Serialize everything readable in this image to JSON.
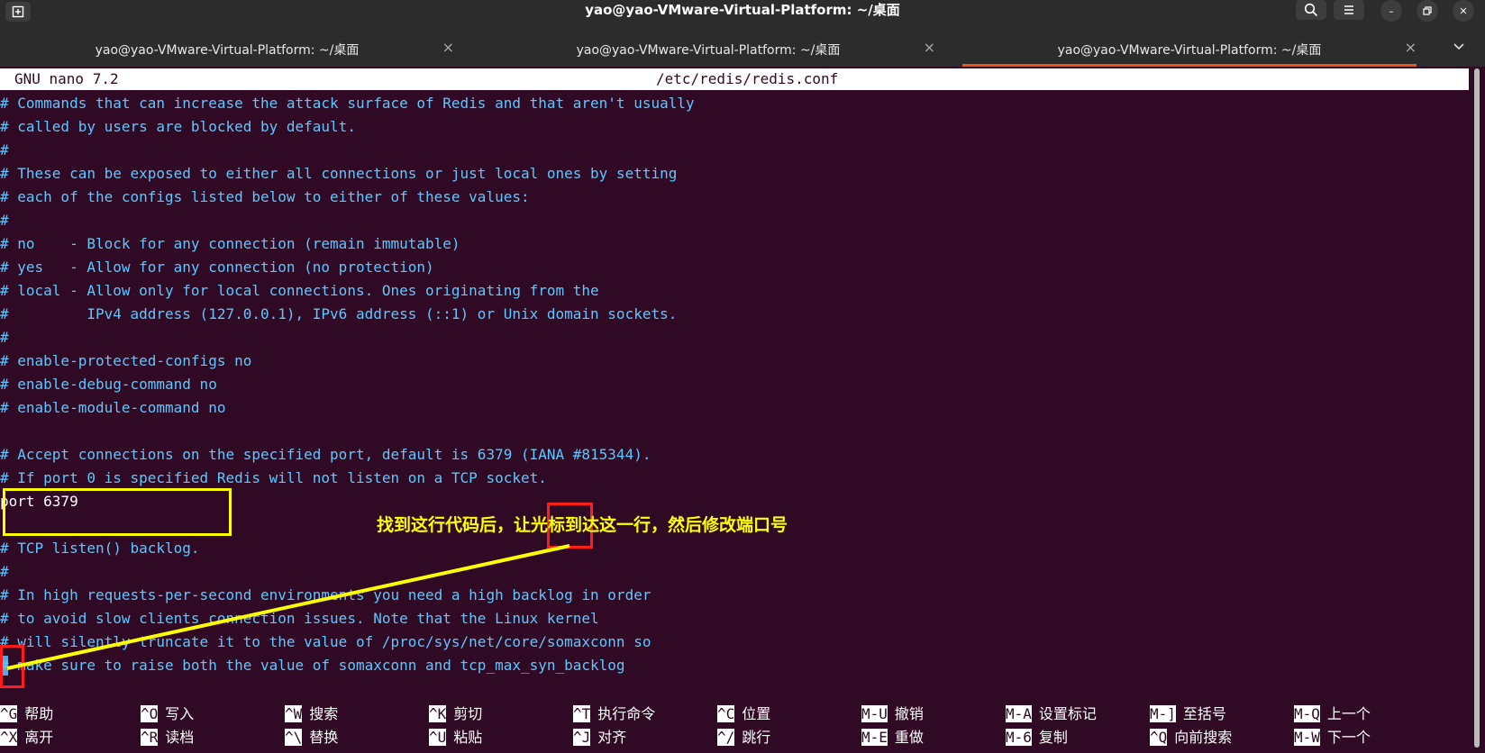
{
  "window": {
    "title": "yao@yao-VMware-Virtual-Platform: ~/桌面"
  },
  "tabs": [
    {
      "label": "yao@yao-VMware-Virtual-Platform: ~/桌面",
      "active": false
    },
    {
      "label": "yao@yao-VMware-Virtual-Platform: ~/桌面",
      "active": false
    },
    {
      "label": "yao@yao-VMware-Virtual-Platform: ~/桌面",
      "active": true
    }
  ],
  "tab_close_glyph": "×",
  "nano": {
    "version": "GNU nano 7.2",
    "filename": "/etc/redis/redis.conf"
  },
  "lines": [
    "# Commands that can increase the attack surface of Redis and that aren't usually",
    "# called by users are blocked by default.",
    "#",
    "# These can be exposed to either all connections or just local ones by setting",
    "# each of the configs listed below to either of these values:",
    "#",
    "# no    - Block for any connection (remain immutable)",
    "# yes   - Allow for any connection (no protection)",
    "# local - Allow only for local connections. Ones originating from the",
    "#         IPv4 address (127.0.0.1), IPv6 address (::1) or Unix domain sockets.",
    "#",
    "# enable-protected-configs no",
    "# enable-debug-command no",
    "# enable-module-command no",
    "",
    "# Accept connections on the specified port, default is 6379 (IANA #815344).",
    "# If port 0 is specified Redis will not listen on a TCP socket.",
    "port 6379",
    "",
    "# TCP listen() backlog.",
    "#",
    "# In high requests-per-second environments you need a high backlog in order",
    "# to avoid slow clients connection issues. Note that the Linux kernel",
    "# will silently truncate it to the value of /proc/sys/net/core/somaxconn so",
    "# make sure to raise both the value of somaxconn and tcp_max_syn_backlog"
  ],
  "shortcuts_row1": [
    {
      "key": "^G",
      "desc": "帮助"
    },
    {
      "key": "^O",
      "desc": "写入"
    },
    {
      "key": "^W",
      "desc": "搜索"
    },
    {
      "key": "^K",
      "desc": "剪切"
    },
    {
      "key": "^T",
      "desc": "执行命令"
    },
    {
      "key": "^C",
      "desc": "位置"
    },
    {
      "key": "M-U",
      "desc": "撤销"
    },
    {
      "key": "M-A",
      "desc": "设置标记"
    },
    {
      "key": "M-]",
      "desc": "至括号"
    },
    {
      "key": "M-Q",
      "desc": "上一个"
    }
  ],
  "shortcuts_row2": [
    {
      "key": "^X",
      "desc": "离开"
    },
    {
      "key": "^R",
      "desc": "读档"
    },
    {
      "key": "^\\",
      "desc": "替换"
    },
    {
      "key": "^U",
      "desc": "粘贴"
    },
    {
      "key": "^J",
      "desc": "对齐"
    },
    {
      "key": "^/",
      "desc": "跳行"
    },
    {
      "key": "M-E",
      "desc": "重做"
    },
    {
      "key": "M-6",
      "desc": "复制"
    },
    {
      "key": "^Q",
      "desc": "向前搜索"
    },
    {
      "key": "M-W",
      "desc": "下一个"
    }
  ],
  "annotation": {
    "text": "找到这行代码后，让光标到达这一行，然后修改端口号"
  },
  "icons": {
    "new_tab": "new-tab-icon",
    "search": "search-icon",
    "menu": "hamburger-menu-icon",
    "minimize": "minimize-icon",
    "maximize": "restore-icon",
    "close": "close-icon",
    "tab_dropdown": "chevron-down-icon"
  },
  "colors": {
    "background": "#300a24",
    "comment": "#5cc8ff",
    "annotation_yellow": "#ffff00",
    "annotation_red": "#ff1c1c",
    "tab_accent": "#e95420"
  }
}
